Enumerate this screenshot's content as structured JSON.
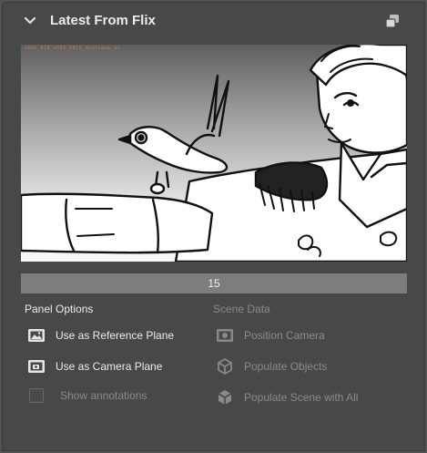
{
  "header": {
    "title": "Latest From Flix",
    "collapse_icon": "chevron-down-icon",
    "popout_icon": "popout-window-icon"
  },
  "thumbnail": {
    "overlay_text": "shot_010_v002_0015_dialogue_sc"
  },
  "frame": {
    "number": "15"
  },
  "panel_options": {
    "heading": "Panel Options",
    "items": [
      {
        "label": "Use as Reference Plane",
        "icon": "image-plane-icon",
        "enabled": true
      },
      {
        "label": "Use as Camera Plane",
        "icon": "camera-plane-icon",
        "enabled": true
      },
      {
        "label": "Show annotations",
        "icon": "checkbox",
        "enabled": false
      }
    ]
  },
  "scene_data": {
    "heading": "Scene Data",
    "items": [
      {
        "label": "Position Camera",
        "icon": "position-camera-icon",
        "enabled": false
      },
      {
        "label": "Populate Objects",
        "icon": "cube-icon",
        "enabled": false
      },
      {
        "label": "Populate Scene with All",
        "icon": "cube-icon",
        "enabled": false
      }
    ]
  },
  "colors": {
    "background": "#535353",
    "panel": "#484848",
    "frame_bar": "#7d7d7d",
    "text_enabled": "#ececec",
    "text_disabled": "#8a8a8a",
    "overlay_text": "#d6783a"
  }
}
